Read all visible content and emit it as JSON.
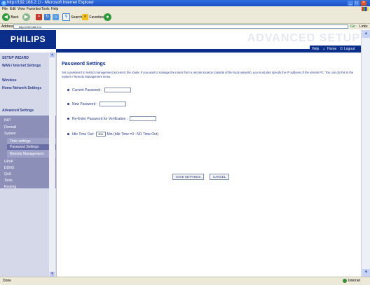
{
  "window": {
    "title": "http://192.168.2.1/ - Microsoft Internet Explorer",
    "menu": [
      "File",
      "Edit",
      "View",
      "Favorites",
      "Tools",
      "Help"
    ]
  },
  "toolbar": {
    "back_label": "Back",
    "search_label": "Search",
    "favorites_label": "Favorites"
  },
  "address": {
    "label": "Address",
    "url": "http://192.168.2.1/",
    "go_label": "Go",
    "links_label": "Links"
  },
  "header": {
    "logo": "PHILIPS",
    "title": "ADVANCED SETUP",
    "help_label": "Help",
    "home_label": "Home",
    "logout_label": "Logout"
  },
  "sidebar": {
    "items": [
      "SETUP WIZARD",
      "WAN / Internet Settings",
      "Wireless",
      "Home Network Settings",
      "Advanced Settings",
      "NAT",
      "Firewall",
      "System",
      "Time settings",
      "Password Settings",
      "Remote Management",
      "UPnP",
      "DDNS",
      "QoS",
      "Tools",
      "Routing"
    ]
  },
  "main": {
    "page_title": "Password Settings",
    "intro": "Set a password to restrict management access to the router. If you want to manage the router from a remote location (outside of the local network), you must also specify the IP address of the remote PC. You can do this in the System / Remote Management menu.",
    "current_password_label": "Current Password :",
    "new_password_label": "New Password :",
    "reenter_label": "Re-Enter Password for Verification :",
    "idle_label": "Idle Time Out:",
    "idle_value": "300",
    "idle_suffix": "Min (Idle Time =0 : NO Time Out)",
    "save_button": "SAVE SETTINGS",
    "cancel_button": "CANCEL"
  },
  "status": {
    "left": "Done",
    "right": "Internet"
  }
}
